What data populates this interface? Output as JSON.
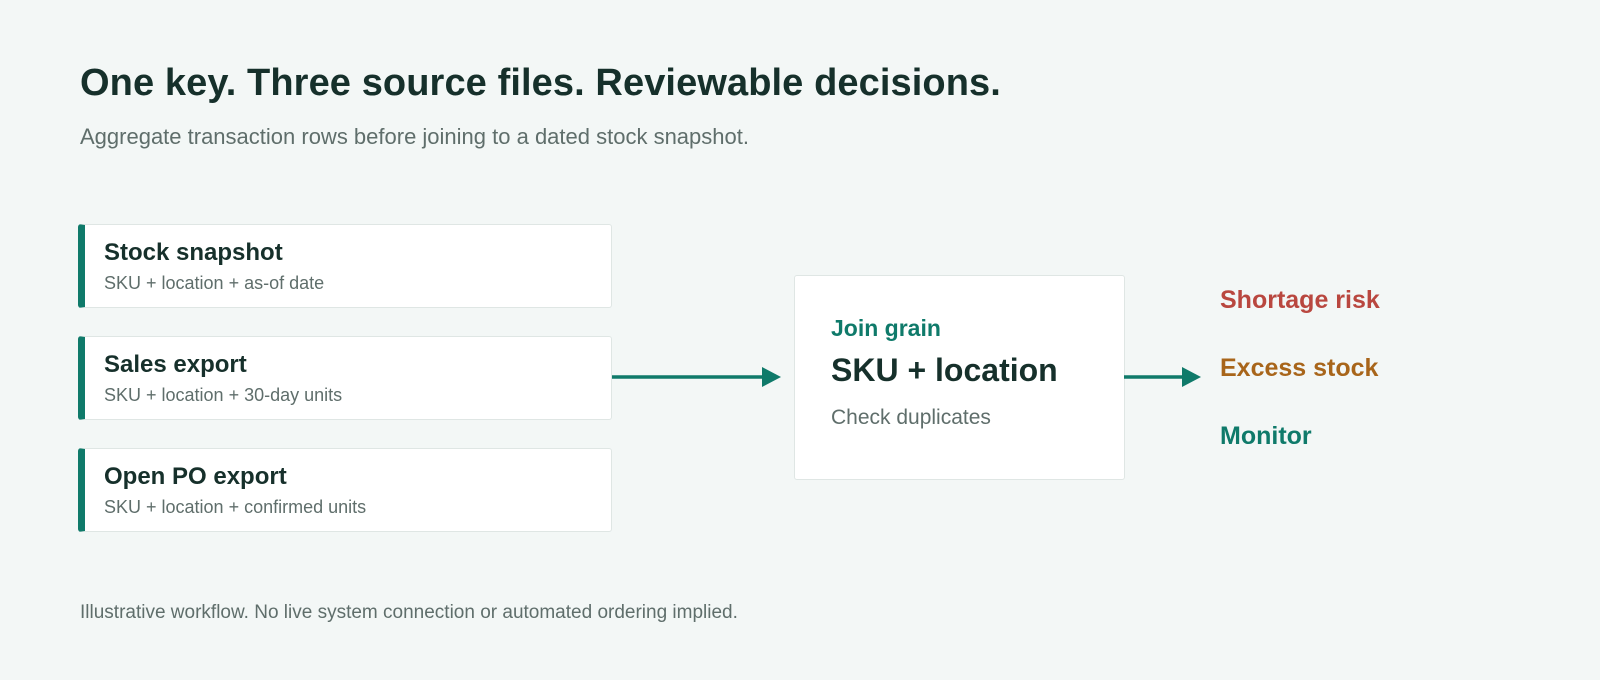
{
  "header": {
    "title": "One key. Three source files. Reviewable decisions.",
    "subtitle": "Aggregate transaction rows before joining to a dated stock snapshot."
  },
  "sources": [
    {
      "title": "Stock snapshot",
      "subtitle": "SKU + location + as-of date"
    },
    {
      "title": "Sales export",
      "subtitle": "SKU + location + 30-day units"
    },
    {
      "title": "Open PO export",
      "subtitle": "SKU + location + confirmed units"
    }
  ],
  "join": {
    "label": "Join grain",
    "key": "SKU + location",
    "note": "Check duplicates"
  },
  "outcomes": [
    {
      "label": "Shortage risk",
      "color": "#b9473f"
    },
    {
      "label": "Excess stock",
      "color": "#a8651a"
    },
    {
      "label": "Monitor",
      "color": "#0f7a6a"
    }
  ],
  "footer": {
    "note": "Illustrative workflow. No live system connection or automated ordering implied."
  },
  "colors": {
    "accent": "#0f7a6a",
    "heading": "#16302b",
    "muted": "#5f6e6b",
    "background": "#f3f7f6"
  }
}
